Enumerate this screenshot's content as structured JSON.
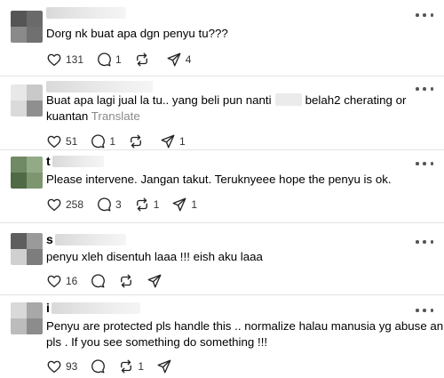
{
  "comments": [
    {
      "username_initial": "",
      "text_lines": [
        "Dorg nk buat apa dgn penyu tu???"
      ],
      "likes": "131",
      "replies": "1",
      "reposts": "",
      "shares": "4"
    },
    {
      "username_initial": "",
      "text_lines": [
        "Buat apa lagi jual la tu.. yang beli pun nanti",
        "belah2 cherating or",
        "kuantan"
      ],
      "translate_label": "Translate",
      "likes": "51",
      "replies": "1",
      "reposts": "",
      "shares": "1"
    },
    {
      "username_initial": "t",
      "text_lines": [
        "Please intervene. Jangan takut. Teruknyeee hope the penyu is ok."
      ],
      "likes": "258",
      "replies": "3",
      "reposts": "1",
      "shares": "1"
    },
    {
      "username_initial": "s",
      "text_lines": [
        "penyu xleh disentuh laaa !!! eish aku laaa"
      ],
      "likes": "16",
      "replies": "",
      "reposts": "",
      "shares": ""
    },
    {
      "username_initial": "i",
      "text_lines": [
        "Penyu are protected pls handle this .. normalize halau manusia yg abuse animal",
        "pls . If you see something do something !!!"
      ],
      "likes": "93",
      "replies": "",
      "reposts": "1",
      "shares": ""
    }
  ],
  "icons": {
    "like": "heart-icon",
    "reply": "speech-bubble-icon",
    "repost": "repost-arrows-icon",
    "share": "paper-plane-icon",
    "more": "more-dots-icon"
  }
}
